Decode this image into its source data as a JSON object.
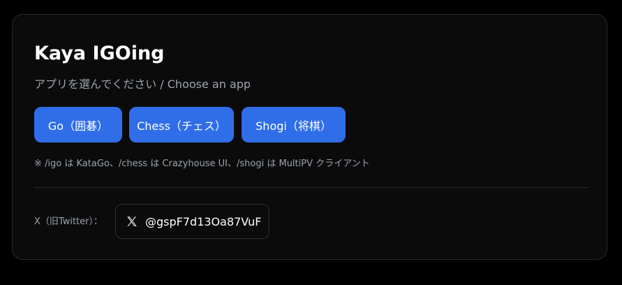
{
  "app": {
    "title": "Kaya IGOing",
    "subtitle": "アプリを選んでください / Choose an app"
  },
  "apps": [
    {
      "label": "Go（囲碁）"
    },
    {
      "label": "Chess（チェス）"
    },
    {
      "label": "Shogi（将棋）"
    }
  ],
  "note": "※ /igo は KataGo、/chess は Crazyhouse UI、/shogi は MultiPV クライアント",
  "social": {
    "label": "X（旧Twitter）：",
    "icon": "x-logo-icon",
    "handle": "@gspF7d13Oa87VuF"
  },
  "colors": {
    "background": "#000000",
    "card": "#0b0b0b",
    "accent": "#2f6ee8",
    "muted_text": "#9ca3af",
    "border": "#2a2a2a"
  }
}
